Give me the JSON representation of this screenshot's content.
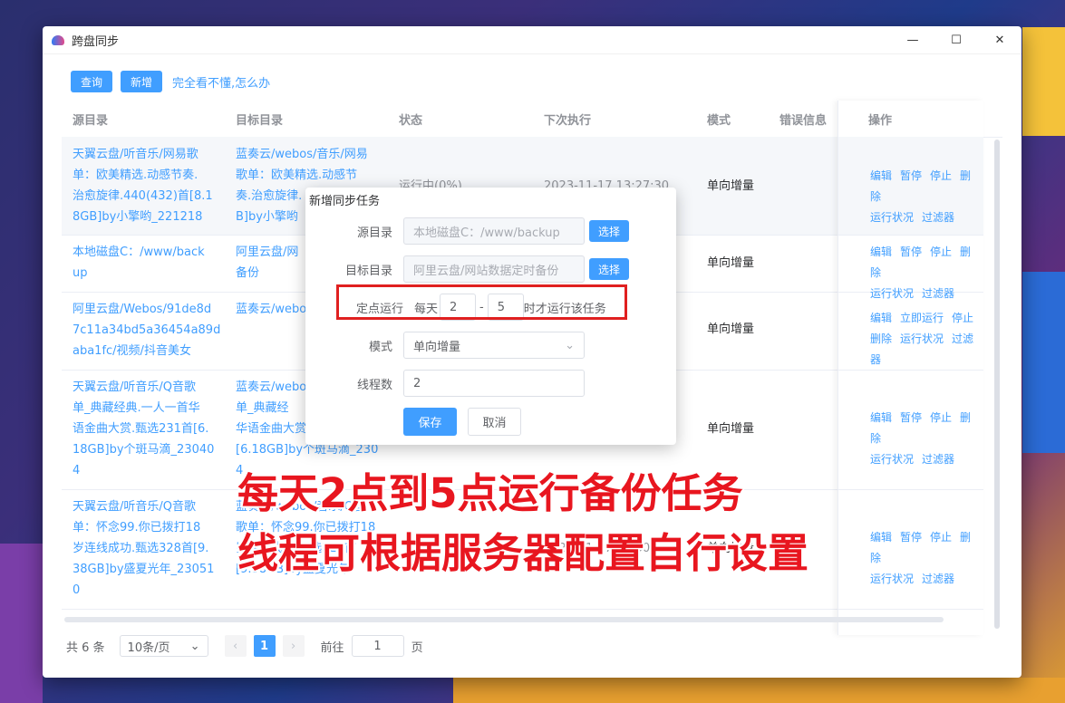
{
  "window": {
    "title": "跨盘同步",
    "minimize": "—",
    "maximize": "☐",
    "close": "✕"
  },
  "toolbar": {
    "query_label": "查询",
    "add_label": "新增",
    "help_link": "完全看不懂,怎么办"
  },
  "table": {
    "headers": {
      "source": "源目录",
      "target": "目标目录",
      "status": "状态",
      "next_run": "下次执行",
      "mode": "模式",
      "error": "错误信息",
      "ops": "操作"
    },
    "rows": [
      {
        "source": [
          "天翼云盘/听音乐/网易歌",
          "单：欧美精选.动感节奏.",
          "治愈旋律.440(432)首[8.1",
          "8GB]by小擎哟_221218"
        ],
        "target": [
          "蓝奏云/webos/音乐/网易",
          "歌单：欧美精选.动感节",
          "奏.治愈旋律.",
          "B]by小擎哟"
        ],
        "status": "运行中(0%)",
        "next_run": "2023-11-17 13:27:30",
        "mode": "单向增量",
        "ops1": [
          "编辑",
          "暂停",
          "停止",
          "删除"
        ],
        "ops2": [
          "运行状况",
          "过滤器"
        ]
      },
      {
        "source": [
          "本地磁盘C：/www/back",
          "up"
        ],
        "target": [
          "阿里云盘/网",
          "备份"
        ],
        "mode": "单向增量",
        "ops1": [
          "编辑",
          "暂停",
          "停止",
          "删除"
        ],
        "ops2": [
          "运行状况",
          "过滤器"
        ]
      },
      {
        "source": [
          "阿里云盘/Webos/91de8d",
          "7c11a34bd5a36454a89d",
          "aba1fc/视频/抖音美女"
        ],
        "target": [
          "蓝奏云/webo"
        ],
        "mode": "单向增量",
        "ops1": [
          "编辑",
          "立即运行",
          "停止"
        ],
        "ops2": [
          "删除",
          "运行状况",
          "过滤器"
        ]
      },
      {
        "source": [
          "天翼云盘/听音乐/Q音歌",
          "单_典藏经典.一人一首华",
          "语金曲大赏.甄选231首[6.",
          "18GB]by个斑马滴_23040",
          "4"
        ],
        "target": [
          "蓝奏云/webo",
          "单_典藏经",
          "华语金曲大赏",
          "[6.18GB]by个斑马滴_230",
          "4"
        ],
        "mode": "单向增量",
        "ops1": [
          "编辑",
          "暂停",
          "停止",
          "删除"
        ],
        "ops2": [
          "运行状况",
          "过滤器"
        ]
      },
      {
        "source": [
          "天翼云盘/听音乐/Q音歌",
          "单：怀念99.你已拨打18",
          "岁连线成功.甄选328首[9.",
          "38GB]by盛夏光年_23051",
          "0"
        ],
        "target": [
          "蓝奏云/webos/音乐/Q音",
          "歌单：怀念99.你已拨打18",
          "岁连线成功.甄选328首",
          "[9.38GB]by盛夏光年"
        ],
        "next_run": "2023-11-17 13:30",
        "mode": "单向增量",
        "ops1": [
          "编辑",
          "暂停",
          "停止",
          "删除"
        ],
        "ops2": [
          "运行状况",
          "过滤器"
        ]
      }
    ]
  },
  "pagination": {
    "total": "共 6 条",
    "page_size": "10条/页",
    "current": "1",
    "goto_label": "前往",
    "goto_value": "1",
    "page_suffix": "页"
  },
  "dialog": {
    "title": "新增同步任务",
    "source_label": "源目录",
    "source_value": "本地磁盘C：/www/backup",
    "target_label": "目标目录",
    "target_value": "阿里云盘/网站数据定时备份",
    "choose_label": "选择",
    "schedule_label": "定点运行",
    "schedule_prefix": "每天",
    "start_hour": "2",
    "dash": "-",
    "end_hour": "5",
    "schedule_suffix": "时才运行该任务",
    "mode_label": "模式",
    "mode_value": "单向增量",
    "threads_label": "线程数",
    "threads_value": "2",
    "save_label": "保存",
    "cancel_label": "取消"
  },
  "captions": {
    "line1": "每天2点到5点运行备份任务",
    "line2": "线程可根据服务器配置自行设置"
  },
  "colors": {
    "primary": "#409eff",
    "caption": "#e8161f",
    "highlight": "#e02020"
  }
}
